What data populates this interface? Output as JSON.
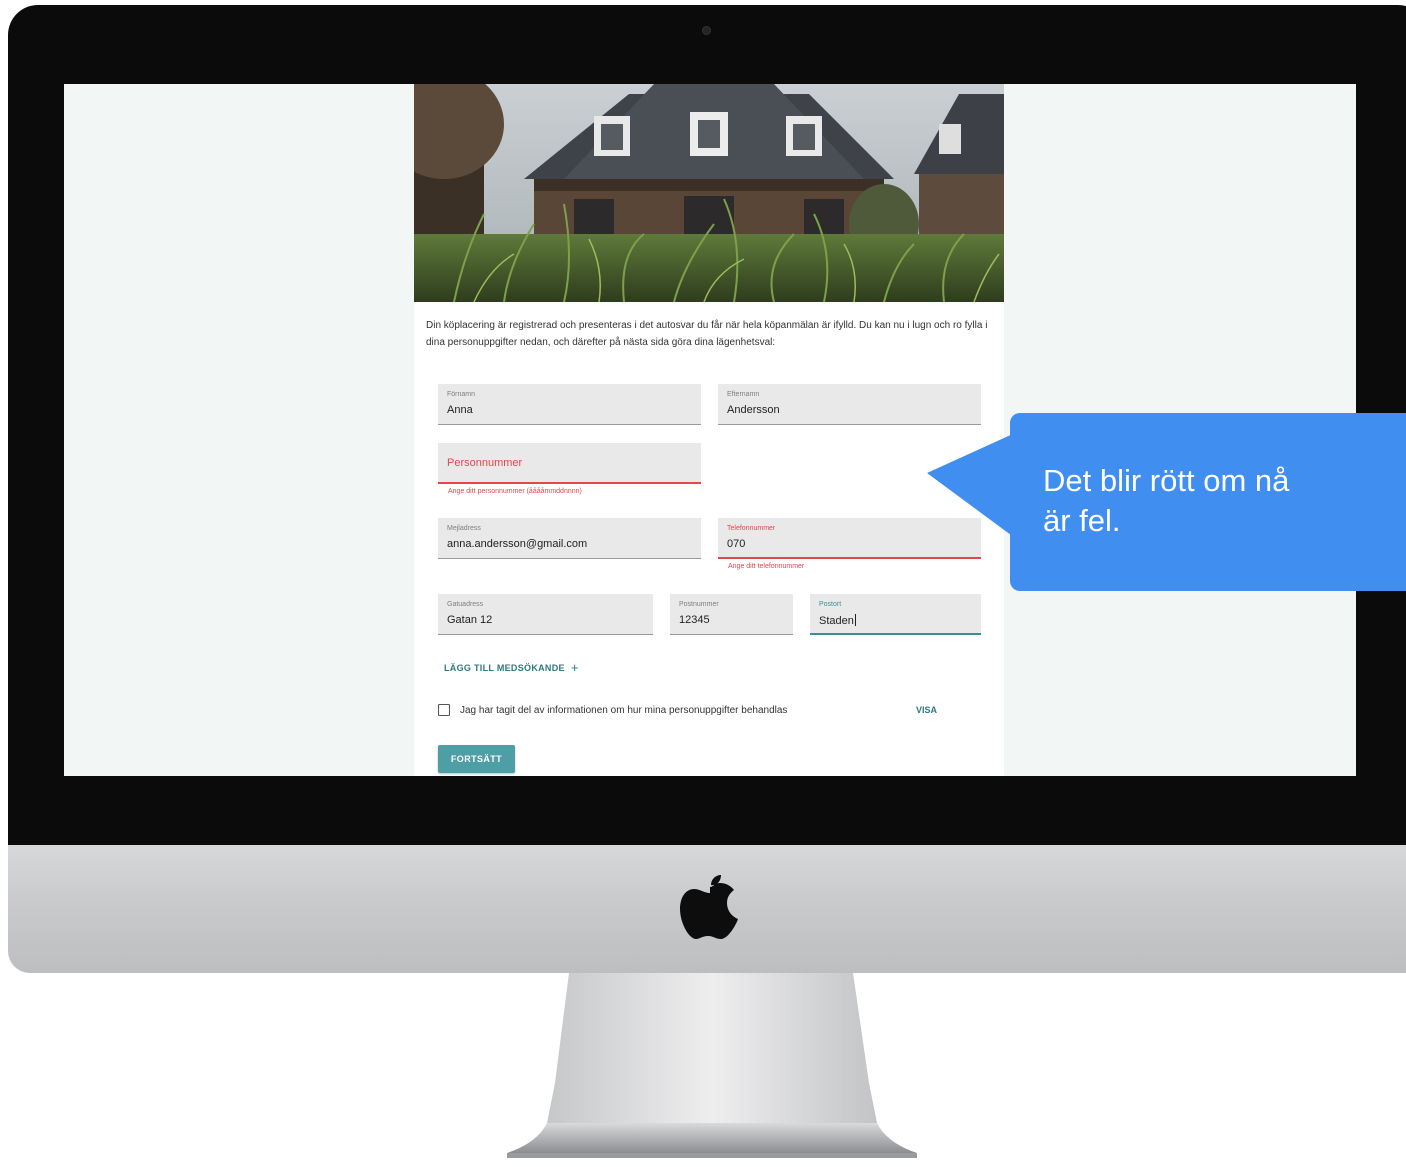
{
  "form": {
    "intro": "Din köplacering är registrerad och presenteras i det autosvar du får när hela köpanmälan är ifylld. Du kan nu i lugn och ro fylla i dina personuppgifter nedan, och därefter på nästa sida göra dina lägenhetsval:",
    "first_name": {
      "label": "Förnamn",
      "value": "Anna"
    },
    "last_name": {
      "label": "Efternamn",
      "value": "Andersson"
    },
    "personal_number": {
      "placeholder": "Personnummer",
      "error": "Ange ditt personnummer (ååååmmddnnnn)"
    },
    "email": {
      "label": "Mejladress",
      "value": "anna.andersson@gmail.com"
    },
    "phone": {
      "label": "Telefonnummer",
      "value": "070",
      "error": "Ange ditt telefonnummer"
    },
    "street": {
      "label": "Gatuadress",
      "value": "Gatan 12"
    },
    "postal_code": {
      "label": "Postnummer",
      "value": "12345"
    },
    "city": {
      "label": "Postort",
      "value": "Staden"
    },
    "add_coapplicant_label": "LÄGG TILL MEDSÖKANDE",
    "consent_label": "Jag har tagit del av informationen om hur mina personuppgifter behandlas",
    "visa_label": "VISA",
    "continue_label": "FORTSÄTT"
  },
  "callout": {
    "line1": "Det blir rött om nå",
    "line2": "är fel."
  },
  "colors": {
    "accent": "#3c8d92",
    "error": "#e2474c",
    "button": "#4d9ea5",
    "callout": "#3f8ef0"
  },
  "icons": {
    "plus": "+",
    "apple": "apple-logo-icon"
  }
}
